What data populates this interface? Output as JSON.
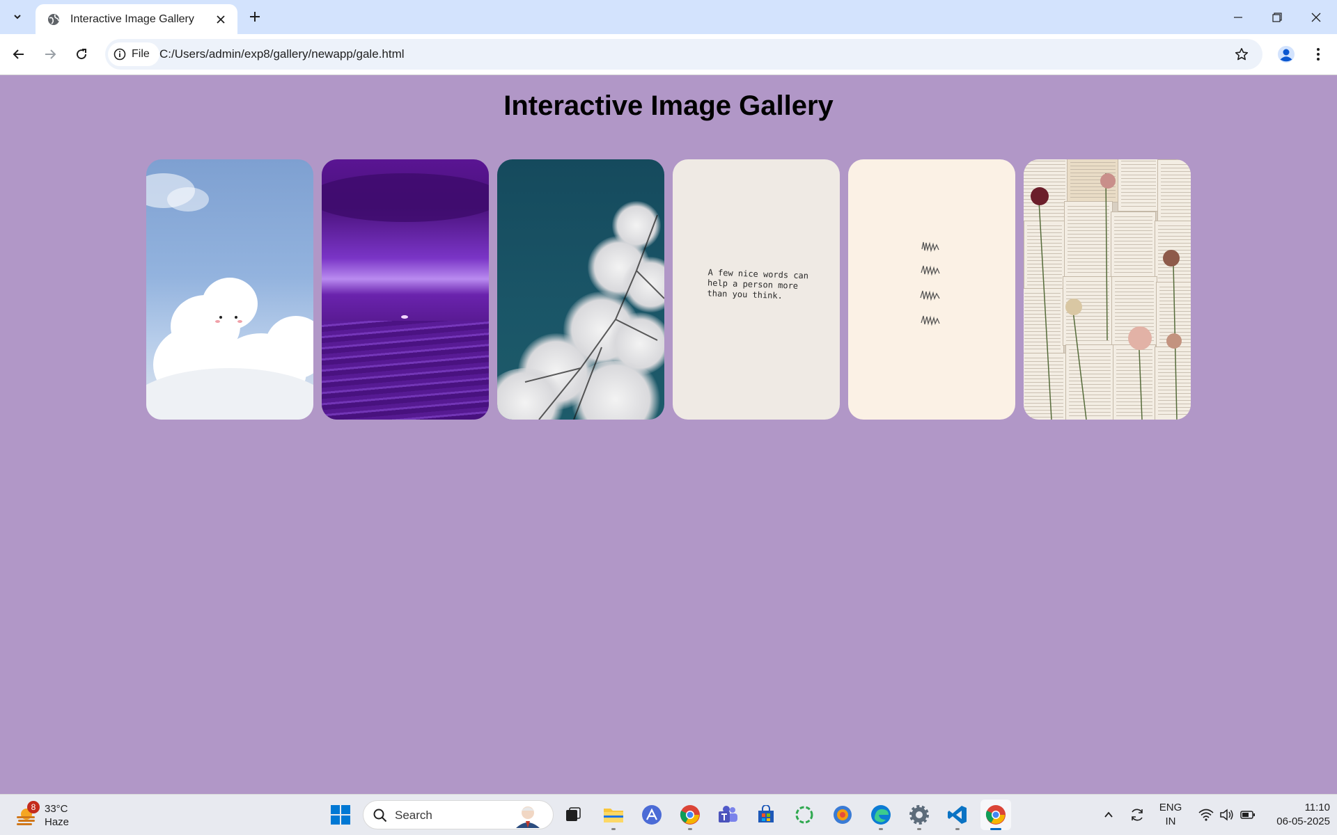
{
  "browser": {
    "tab_title": "Interactive Image Gallery",
    "chip_label": "File",
    "url": "C:/Users/admin/exp8/gallery/newapp/gale.html"
  },
  "page": {
    "title": "Interactive Image Gallery",
    "gallery": [
      {
        "name": "sky-clouds"
      },
      {
        "name": "purple-sea"
      },
      {
        "name": "white-blossoms"
      },
      {
        "name": "handwritten-note",
        "text": "A few nice words can help a person more than you think."
      },
      {
        "name": "cream-scribbles"
      },
      {
        "name": "books-and-flowers"
      }
    ]
  },
  "taskbar": {
    "weather_temp": "33°C",
    "weather_cond": "Haze",
    "weather_badge": "8",
    "search_label": "Search",
    "lang_line1": "ENG",
    "lang_line2": "IN",
    "time": "11:10",
    "date": "06-05-2025"
  },
  "colors": {
    "page_background": "#b197c7",
    "tabbar": "#d3e3fd",
    "omnibox": "#edf2fa",
    "taskbar": "#e8eaf0",
    "accent": "#0067c0"
  }
}
